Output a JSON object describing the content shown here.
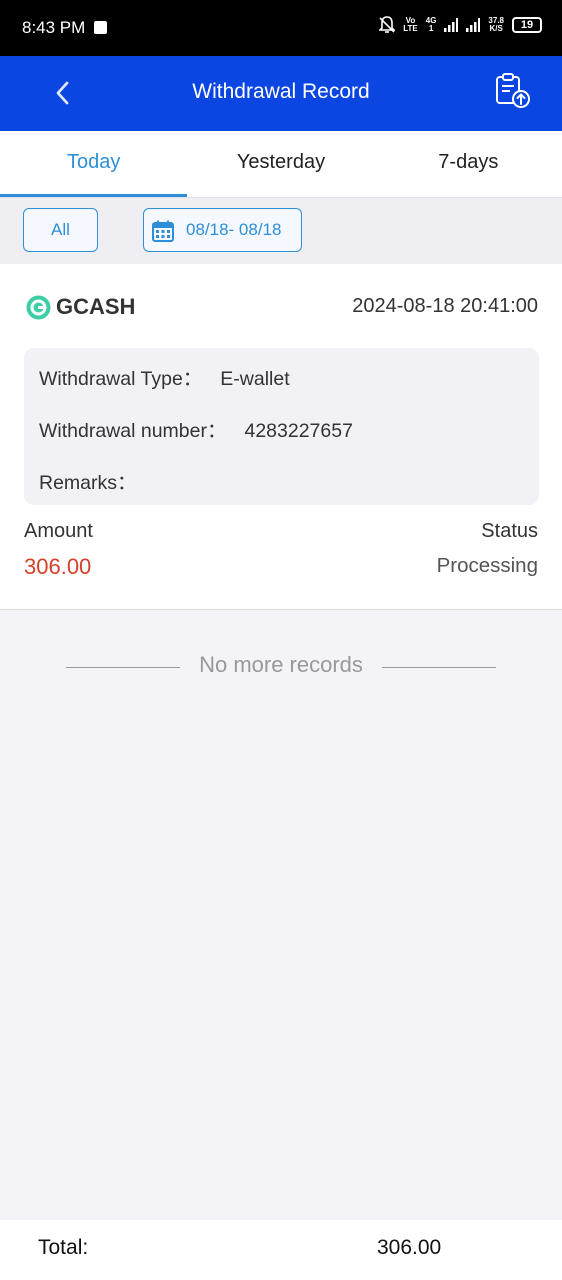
{
  "status_bar": {
    "time": "8:43 PM",
    "network_top": "Vo",
    "network_bottom": "LTE",
    "net_type_top": "4G",
    "net_type_bottom": "1",
    "speed_top": "37.8",
    "speed_bottom": "K/S",
    "battery": "19"
  },
  "header": {
    "title": "Withdrawal Record",
    "back_icon": "chevron-left-icon",
    "action_icon": "clipboard-upload-icon"
  },
  "tabs": [
    {
      "label": "Today",
      "active": true
    },
    {
      "label": "Yesterday",
      "active": false
    },
    {
      "label": "7-days",
      "active": false
    }
  ],
  "filters": {
    "all_label": "All",
    "date_range": "08/18- 08/18"
  },
  "record": {
    "provider": "GCASH",
    "datetime": "2024-08-18 20:41:00",
    "type_label": "Withdrawal Type：",
    "type_value": "E-wallet",
    "number_label": "Withdrawal number：",
    "number_value": "4283227657",
    "remarks_label": "Remarks：",
    "remarks_value": "",
    "amount_label": "Amount",
    "amount_value": "306.00",
    "status_label": "Status",
    "status_value": "Processing"
  },
  "list_end_text": "No more records",
  "footer": {
    "total_label": "Total:",
    "total_value": "306.00"
  },
  "colors": {
    "header_bg": "#0b46e3",
    "accent": "#2e8fd8",
    "amount": "#d6402a",
    "gcash_green": "#3ccfa5"
  }
}
